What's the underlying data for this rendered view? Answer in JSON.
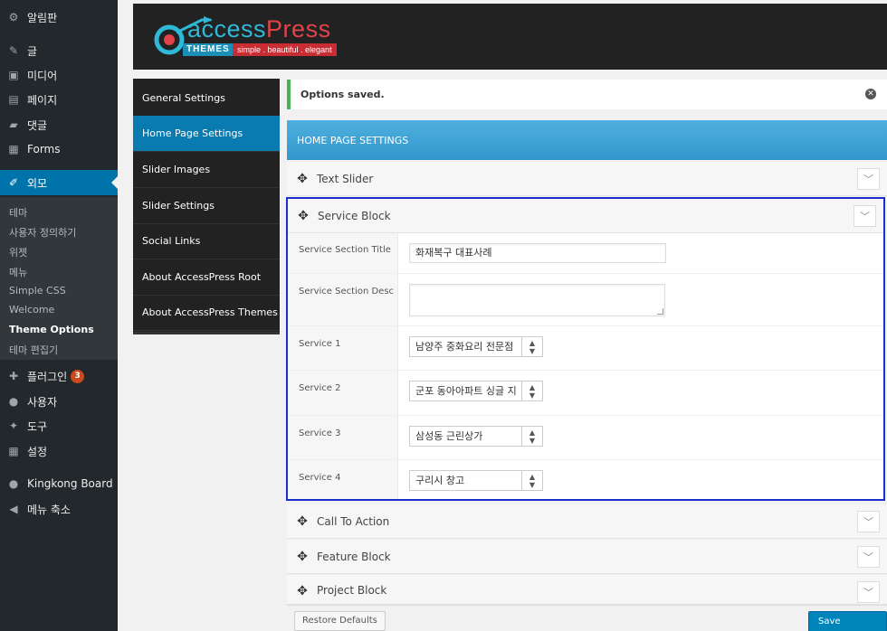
{
  "sidebar": {
    "items": [
      {
        "label": "알림판",
        "icon": "dashboard-icon",
        "glyph": "⚙"
      },
      {
        "label": "글",
        "icon": "pin-icon",
        "glyph": "✎"
      },
      {
        "label": "미디어",
        "icon": "media-icon",
        "glyph": "▣"
      },
      {
        "label": "페이지",
        "icon": "page-icon",
        "glyph": "▤"
      },
      {
        "label": "댓글",
        "icon": "comment-icon",
        "glyph": "▰"
      },
      {
        "label": "Forms",
        "icon": "forms-icon",
        "glyph": "▦"
      },
      {
        "label": "외모",
        "icon": "appearance-icon",
        "glyph": "✐"
      },
      {
        "label": "플러그인",
        "icon": "plugin-icon",
        "glyph": "✚",
        "badge": "3"
      },
      {
        "label": "사용자",
        "icon": "user-icon",
        "glyph": "●"
      },
      {
        "label": "도구",
        "icon": "wrench-icon",
        "glyph": "✦"
      },
      {
        "label": "설정",
        "icon": "settings-icon",
        "glyph": "▦"
      },
      {
        "label": "Kingkong Board",
        "icon": "kingkong-icon",
        "glyph": "●"
      },
      {
        "label": "메뉴 축소",
        "icon": "collapse-icon",
        "glyph": "◀"
      }
    ],
    "submenu": [
      "테마",
      "사용자 정의하기",
      "위젯",
      "메뉴",
      "Simple CSS",
      "Welcome",
      "Theme Options",
      "테마 편집기"
    ]
  },
  "brand": {
    "word_access": "access",
    "word_press": "Press",
    "themes": "THEMES",
    "tagline": "simple . beautiful . elegant"
  },
  "options_nav": [
    "General Settings",
    "Home Page Settings",
    "Slider Images",
    "Slider Settings",
    "Social Links",
    "About AccessPress Root",
    "About AccessPress Themes"
  ],
  "notice": {
    "text": "Options saved."
  },
  "section": {
    "title": "HOME PAGE SETTINGS"
  },
  "panels": {
    "text_slider": "Text Slider",
    "service_block": "Service Block",
    "call_to_action": "Call To Action",
    "feature_block": "Feature Block",
    "project_block": "Project Block"
  },
  "service": {
    "title_label": "Service Section Title",
    "title_value": "화재복구 대표사례",
    "desc_label": "Service Section Desc",
    "desc_value": "",
    "services": [
      {
        "label": "Service 1",
        "value": "남양주 중화요리 전문점"
      },
      {
        "label": "Service 2",
        "value": "군포 동아아파트 싱글 지"
      },
      {
        "label": "Service 3",
        "value": "삼성동 근린상가"
      },
      {
        "label": "Service 4",
        "value": "구리시 창고"
      }
    ]
  },
  "footer": {
    "restore": "Restore Defaults",
    "save": "Save Options"
  },
  "colors": {
    "accent": "#0073aa",
    "section_head": "#3fa3d6",
    "highlight_border": "#1a2fcf",
    "notice_success": "#46b450"
  }
}
